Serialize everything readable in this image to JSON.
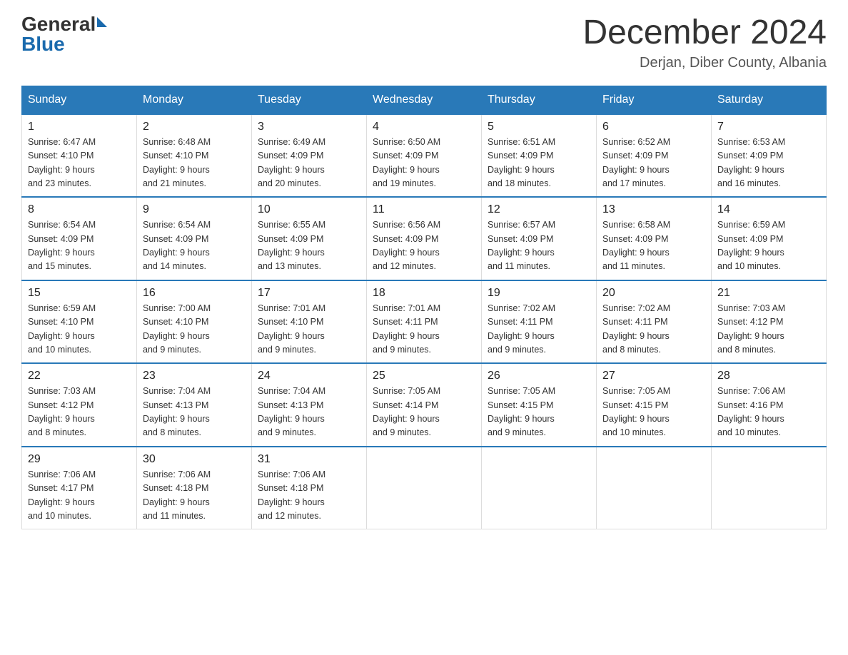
{
  "header": {
    "logo_general": "General",
    "logo_blue": "Blue",
    "month_year": "December 2024",
    "location": "Derjan, Diber County, Albania"
  },
  "days_of_week": [
    "Sunday",
    "Monday",
    "Tuesday",
    "Wednesday",
    "Thursday",
    "Friday",
    "Saturday"
  ],
  "weeks": [
    [
      {
        "day": "1",
        "sunrise": "6:47 AM",
        "sunset": "4:10 PM",
        "daylight": "9 hours and 23 minutes."
      },
      {
        "day": "2",
        "sunrise": "6:48 AM",
        "sunset": "4:10 PM",
        "daylight": "9 hours and 21 minutes."
      },
      {
        "day": "3",
        "sunrise": "6:49 AM",
        "sunset": "4:09 PM",
        "daylight": "9 hours and 20 minutes."
      },
      {
        "day": "4",
        "sunrise": "6:50 AM",
        "sunset": "4:09 PM",
        "daylight": "9 hours and 19 minutes."
      },
      {
        "day": "5",
        "sunrise": "6:51 AM",
        "sunset": "4:09 PM",
        "daylight": "9 hours and 18 minutes."
      },
      {
        "day": "6",
        "sunrise": "6:52 AM",
        "sunset": "4:09 PM",
        "daylight": "9 hours and 17 minutes."
      },
      {
        "day": "7",
        "sunrise": "6:53 AM",
        "sunset": "4:09 PM",
        "daylight": "9 hours and 16 minutes."
      }
    ],
    [
      {
        "day": "8",
        "sunrise": "6:54 AM",
        "sunset": "4:09 PM",
        "daylight": "9 hours and 15 minutes."
      },
      {
        "day": "9",
        "sunrise": "6:54 AM",
        "sunset": "4:09 PM",
        "daylight": "9 hours and 14 minutes."
      },
      {
        "day": "10",
        "sunrise": "6:55 AM",
        "sunset": "4:09 PM",
        "daylight": "9 hours and 13 minutes."
      },
      {
        "day": "11",
        "sunrise": "6:56 AM",
        "sunset": "4:09 PM",
        "daylight": "9 hours and 12 minutes."
      },
      {
        "day": "12",
        "sunrise": "6:57 AM",
        "sunset": "4:09 PM",
        "daylight": "9 hours and 11 minutes."
      },
      {
        "day": "13",
        "sunrise": "6:58 AM",
        "sunset": "4:09 PM",
        "daylight": "9 hours and 11 minutes."
      },
      {
        "day": "14",
        "sunrise": "6:59 AM",
        "sunset": "4:09 PM",
        "daylight": "9 hours and 10 minutes."
      }
    ],
    [
      {
        "day": "15",
        "sunrise": "6:59 AM",
        "sunset": "4:10 PM",
        "daylight": "9 hours and 10 minutes."
      },
      {
        "day": "16",
        "sunrise": "7:00 AM",
        "sunset": "4:10 PM",
        "daylight": "9 hours and 9 minutes."
      },
      {
        "day": "17",
        "sunrise": "7:01 AM",
        "sunset": "4:10 PM",
        "daylight": "9 hours and 9 minutes."
      },
      {
        "day": "18",
        "sunrise": "7:01 AM",
        "sunset": "4:11 PM",
        "daylight": "9 hours and 9 minutes."
      },
      {
        "day": "19",
        "sunrise": "7:02 AM",
        "sunset": "4:11 PM",
        "daylight": "9 hours and 9 minutes."
      },
      {
        "day": "20",
        "sunrise": "7:02 AM",
        "sunset": "4:11 PM",
        "daylight": "9 hours and 8 minutes."
      },
      {
        "day": "21",
        "sunrise": "7:03 AM",
        "sunset": "4:12 PM",
        "daylight": "9 hours and 8 minutes."
      }
    ],
    [
      {
        "day": "22",
        "sunrise": "7:03 AM",
        "sunset": "4:12 PM",
        "daylight": "9 hours and 8 minutes."
      },
      {
        "day": "23",
        "sunrise": "7:04 AM",
        "sunset": "4:13 PM",
        "daylight": "9 hours and 8 minutes."
      },
      {
        "day": "24",
        "sunrise": "7:04 AM",
        "sunset": "4:13 PM",
        "daylight": "9 hours and 9 minutes."
      },
      {
        "day": "25",
        "sunrise": "7:05 AM",
        "sunset": "4:14 PM",
        "daylight": "9 hours and 9 minutes."
      },
      {
        "day": "26",
        "sunrise": "7:05 AM",
        "sunset": "4:15 PM",
        "daylight": "9 hours and 9 minutes."
      },
      {
        "day": "27",
        "sunrise": "7:05 AM",
        "sunset": "4:15 PM",
        "daylight": "9 hours and 10 minutes."
      },
      {
        "day": "28",
        "sunrise": "7:06 AM",
        "sunset": "4:16 PM",
        "daylight": "9 hours and 10 minutes."
      }
    ],
    [
      {
        "day": "29",
        "sunrise": "7:06 AM",
        "sunset": "4:17 PM",
        "daylight": "9 hours and 10 minutes."
      },
      {
        "day": "30",
        "sunrise": "7:06 AM",
        "sunset": "4:18 PM",
        "daylight": "9 hours and 11 minutes."
      },
      {
        "day": "31",
        "sunrise": "7:06 AM",
        "sunset": "4:18 PM",
        "daylight": "9 hours and 12 minutes."
      },
      null,
      null,
      null,
      null
    ]
  ],
  "labels": {
    "sunrise": "Sunrise:",
    "sunset": "Sunset:",
    "daylight": "Daylight:"
  }
}
